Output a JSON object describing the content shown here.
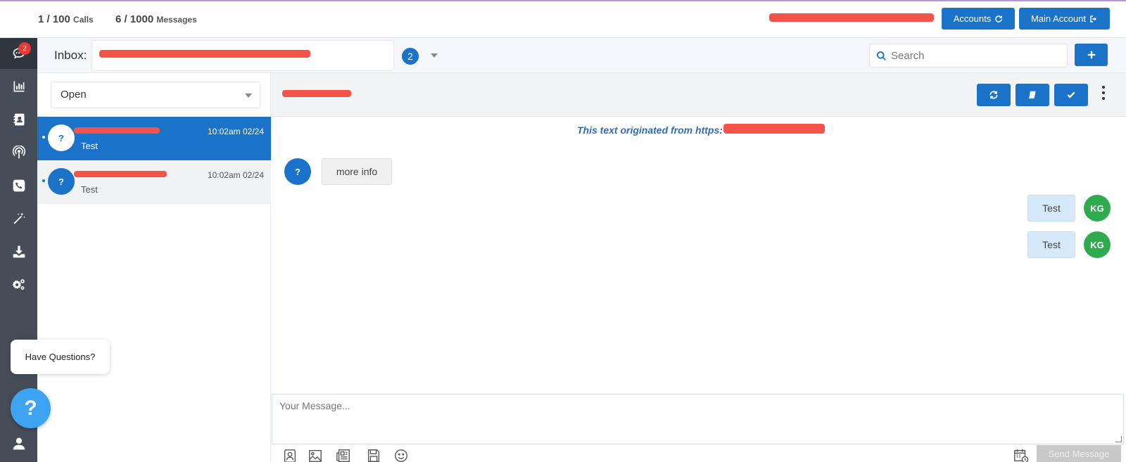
{
  "usage": {
    "calls_count": "1 / 100",
    "calls_label": "Calls",
    "messages_count": "6 / 1000",
    "messages_label": "Messages"
  },
  "header": {
    "accounts_label": "Accounts",
    "main_account_label": "Main Account"
  },
  "sidebar": {
    "items": [
      {
        "icon": "chat-icon",
        "badge": "2",
        "active": true
      },
      {
        "icon": "bar-chart-icon"
      },
      {
        "icon": "contacts-icon"
      },
      {
        "icon": "broadcast-icon"
      },
      {
        "icon": "phone-icon"
      },
      {
        "icon": "magic-wand-icon"
      },
      {
        "icon": "download-icon"
      },
      {
        "icon": "gears-icon"
      },
      {
        "icon": "user-icon"
      }
    ]
  },
  "inbox": {
    "label": "Inbox:",
    "unread_count": "2"
  },
  "search": {
    "placeholder": "Search"
  },
  "filter": {
    "selected": "Open"
  },
  "conversations": [
    {
      "avatar": "?",
      "time": "10:02am 02/24",
      "preview": "Test",
      "selected": true
    },
    {
      "avatar": "?",
      "time": "10:02am 02/24",
      "preview": "Test",
      "selected": false
    }
  ],
  "chat": {
    "origin_text": "This text originated from https:",
    "messages": [
      {
        "direction": "in",
        "avatar": "?",
        "text": "more info"
      },
      {
        "direction": "out",
        "avatar": "KG",
        "text": "Test"
      },
      {
        "direction": "out",
        "avatar": "KG",
        "text": "Test"
      }
    ],
    "composer_placeholder": "Your Message...",
    "send_label": "Send Message"
  },
  "help": {
    "prompt": "Have Questions?",
    "button_glyph": "?"
  },
  "colors": {
    "primary": "#1b72c9",
    "sidebar": "#454d59",
    "avatar_out": "#2eab4f",
    "redaction": "#f25449",
    "help": "#3ea3f2"
  }
}
